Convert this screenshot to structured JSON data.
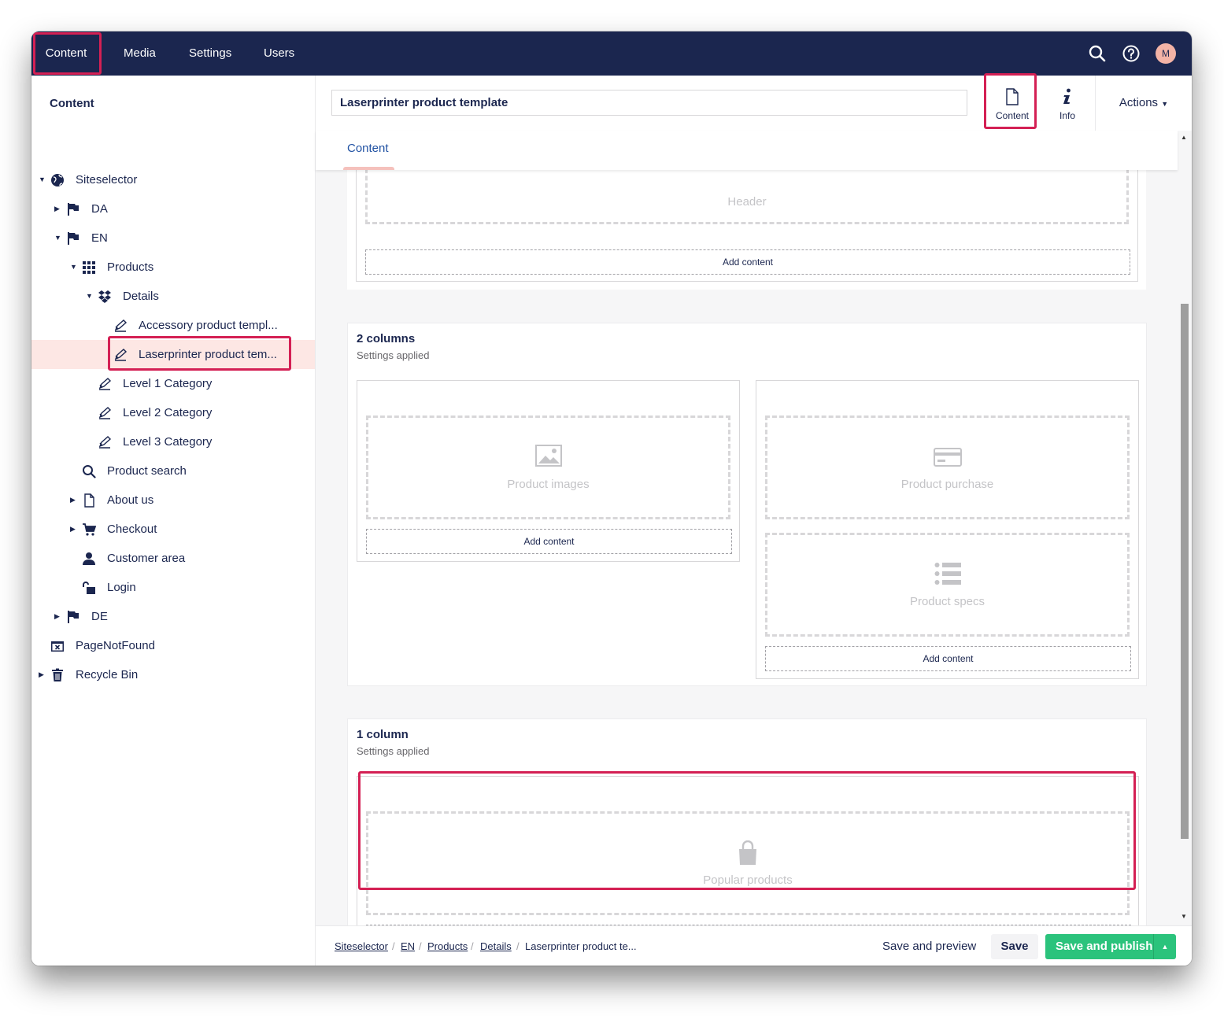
{
  "topnav": {
    "items": [
      {
        "label": "Content",
        "active": true
      },
      {
        "label": "Media"
      },
      {
        "label": "Settings"
      },
      {
        "label": "Users"
      }
    ],
    "avatar_initial": "M",
    "icons": [
      "search-icon",
      "help-icon",
      "user-avatar"
    ]
  },
  "sidebar": {
    "title": "Content",
    "tree": [
      {
        "label": "Siteselector",
        "icon": "globe-icon",
        "expanded": true
      },
      {
        "label": "DA",
        "icon": "flag-icon",
        "expanded": false
      },
      {
        "label": "EN",
        "icon": "flag-icon",
        "expanded": true
      },
      {
        "label": "Products",
        "icon": "grid-icon",
        "expanded": true
      },
      {
        "label": "Details",
        "icon": "dropbox-icon",
        "expanded": true
      },
      {
        "label": "Accessory product templ...",
        "icon": "edit-icon"
      },
      {
        "label": "Laserprinter product tem...",
        "icon": "edit-icon",
        "selected": true
      },
      {
        "label": "Level 1 Category",
        "icon": "edit-icon"
      },
      {
        "label": "Level 2 Category",
        "icon": "edit-icon"
      },
      {
        "label": "Level 3 Category",
        "icon": "edit-icon"
      },
      {
        "label": "Product search",
        "icon": "search-icon"
      },
      {
        "label": "About us",
        "icon": "document-icon",
        "expanded": false
      },
      {
        "label": "Checkout",
        "icon": "cart-icon",
        "expanded": false
      },
      {
        "label": "Customer area",
        "icon": "user-icon"
      },
      {
        "label": "Login",
        "icon": "unlock-icon"
      },
      {
        "label": "DE",
        "icon": "flag-icon",
        "expanded": false
      },
      {
        "label": "PageNotFound",
        "icon": "window-close-icon"
      },
      {
        "label": "Recycle Bin",
        "icon": "trash-icon",
        "expanded": false
      }
    ]
  },
  "editor": {
    "name_value": "Laserprinter product template",
    "apps": [
      {
        "label": "Content",
        "icon": "document-icon"
      },
      {
        "label": "Info",
        "icon": "info-icon"
      }
    ],
    "actions_label": "Actions",
    "tab_label": "Content"
  },
  "grid": {
    "header_area_label": "Header",
    "add_content_label": "Add content",
    "two_col": {
      "title": "2 columns",
      "subtitle": "Settings applied",
      "areas": [
        "Product images",
        "Product purchase",
        "Product specs"
      ]
    },
    "one_col": {
      "title": "1 column",
      "subtitle": "Settings applied",
      "areas": [
        "Popular products"
      ]
    }
  },
  "footer": {
    "breadcrumb": [
      "Siteselector",
      "EN",
      "Products",
      "Details",
      "Laserprinter product te..."
    ],
    "save_preview_label": "Save and preview",
    "save_label": "Save",
    "publish_label": "Save and publish"
  },
  "colors": {
    "topbar": "#1b264f",
    "highlight": "#d42054",
    "publish": "#2bc37c",
    "selected_row": "#fde7e4"
  }
}
